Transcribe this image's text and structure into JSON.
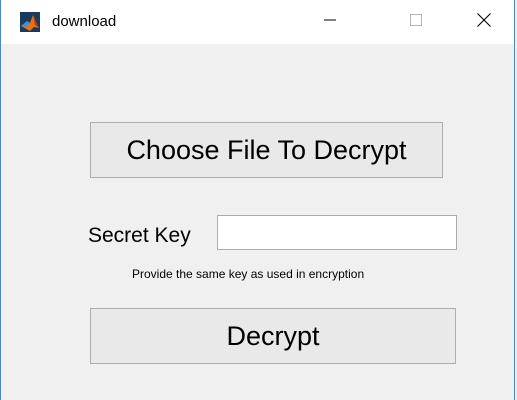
{
  "window": {
    "title": "download",
    "app_icon": "matlab-icon",
    "controls": {
      "minimize_icon": "minimize-icon",
      "maximize_icon": "maximize-icon",
      "close_icon": "close-icon"
    }
  },
  "main": {
    "choose_file_label": "Choose File To Decrypt",
    "secret_key_label": "Secret Key",
    "secret_key_value": "",
    "hint_text": "Provide the same key as used in encryption",
    "decrypt_label": "Decrypt"
  },
  "colors": {
    "button_face": "#e9e9e9",
    "button_border": "#adadad",
    "window_bg": "#f0f0f0",
    "window_border": "#4a86c8"
  }
}
